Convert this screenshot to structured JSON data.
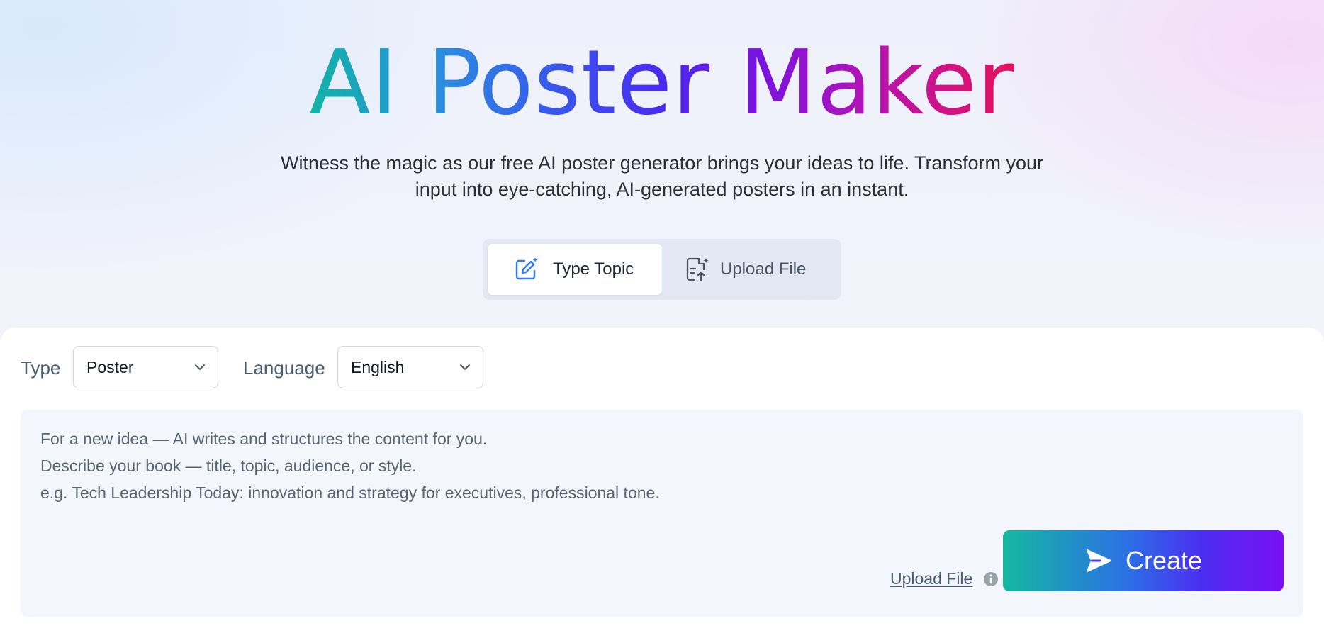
{
  "hero": {
    "title": "AI Poster Maker",
    "subtitle_line1": "Witness the magic as our free AI poster generator brings your ideas to life. Transform your",
    "subtitle_line2": "input into eye-catching, AI-generated posters in an instant."
  },
  "mode_tabs": [
    {
      "label": "Type Topic",
      "icon": "edit-sparkle-icon",
      "active": true
    },
    {
      "label": "Upload File",
      "icon": "file-upload-icon",
      "active": false
    }
  ],
  "form": {
    "type_label": "Type",
    "type_value": "Poster",
    "language_label": "Language",
    "language_value": "English"
  },
  "prompt": {
    "placeholder_lines": [
      "For a new idea — AI writes and structures the content for you.",
      "Describe your book — title, topic, audience, or style.",
      "e.g. Tech Leadership Today: innovation and strategy for executives, professional tone."
    ],
    "upload_link": "Upload File",
    "create_label": "Create"
  },
  "colors": {
    "accent_blue": "#2e7cf6",
    "gradient_start": "#14b8a0",
    "gradient_end": "#7a0ff5",
    "tab_bg": "#e3e8f4",
    "prompt_bg": "#f3f6fd"
  }
}
